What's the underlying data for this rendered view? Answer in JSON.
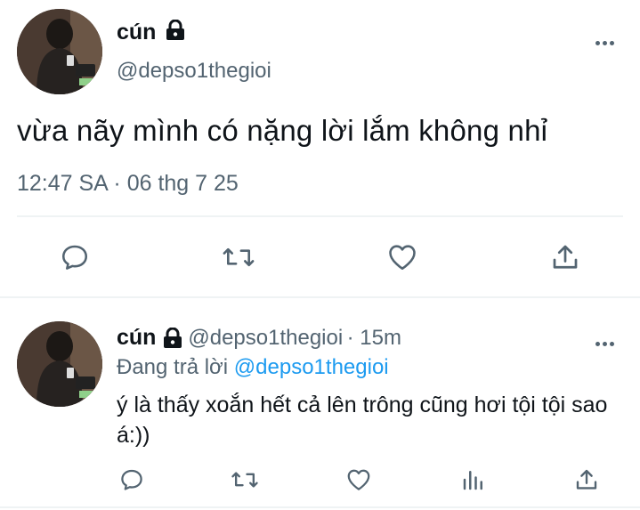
{
  "main_tweet": {
    "display_name": "cún",
    "handle": "@depso1thegioi",
    "text": "vừa nãy mình có nặng lời lắm không nhỉ",
    "timestamp": "12:47 SA · 06 thg 7 25"
  },
  "reply_tweet": {
    "display_name": "cún",
    "handle": "@depso1thegioi",
    "age": "· 15m",
    "replying_prefix": "Đang trả lời",
    "replying_to": "@depso1thegioi",
    "text": "ý là thấy xoắn hết cả lên trông cũng hơi tội tội sao á:))"
  },
  "icons": {
    "reply": "reply-icon",
    "retweet": "retweet-icon",
    "like": "like-icon",
    "share": "share-icon",
    "views": "views-icon",
    "lock": "lock-icon",
    "more": "more-icon"
  },
  "colors": {
    "text": "#0f1419",
    "secondary": "#536471",
    "link": "#1d9bf0",
    "divider": "#eff3f4"
  }
}
